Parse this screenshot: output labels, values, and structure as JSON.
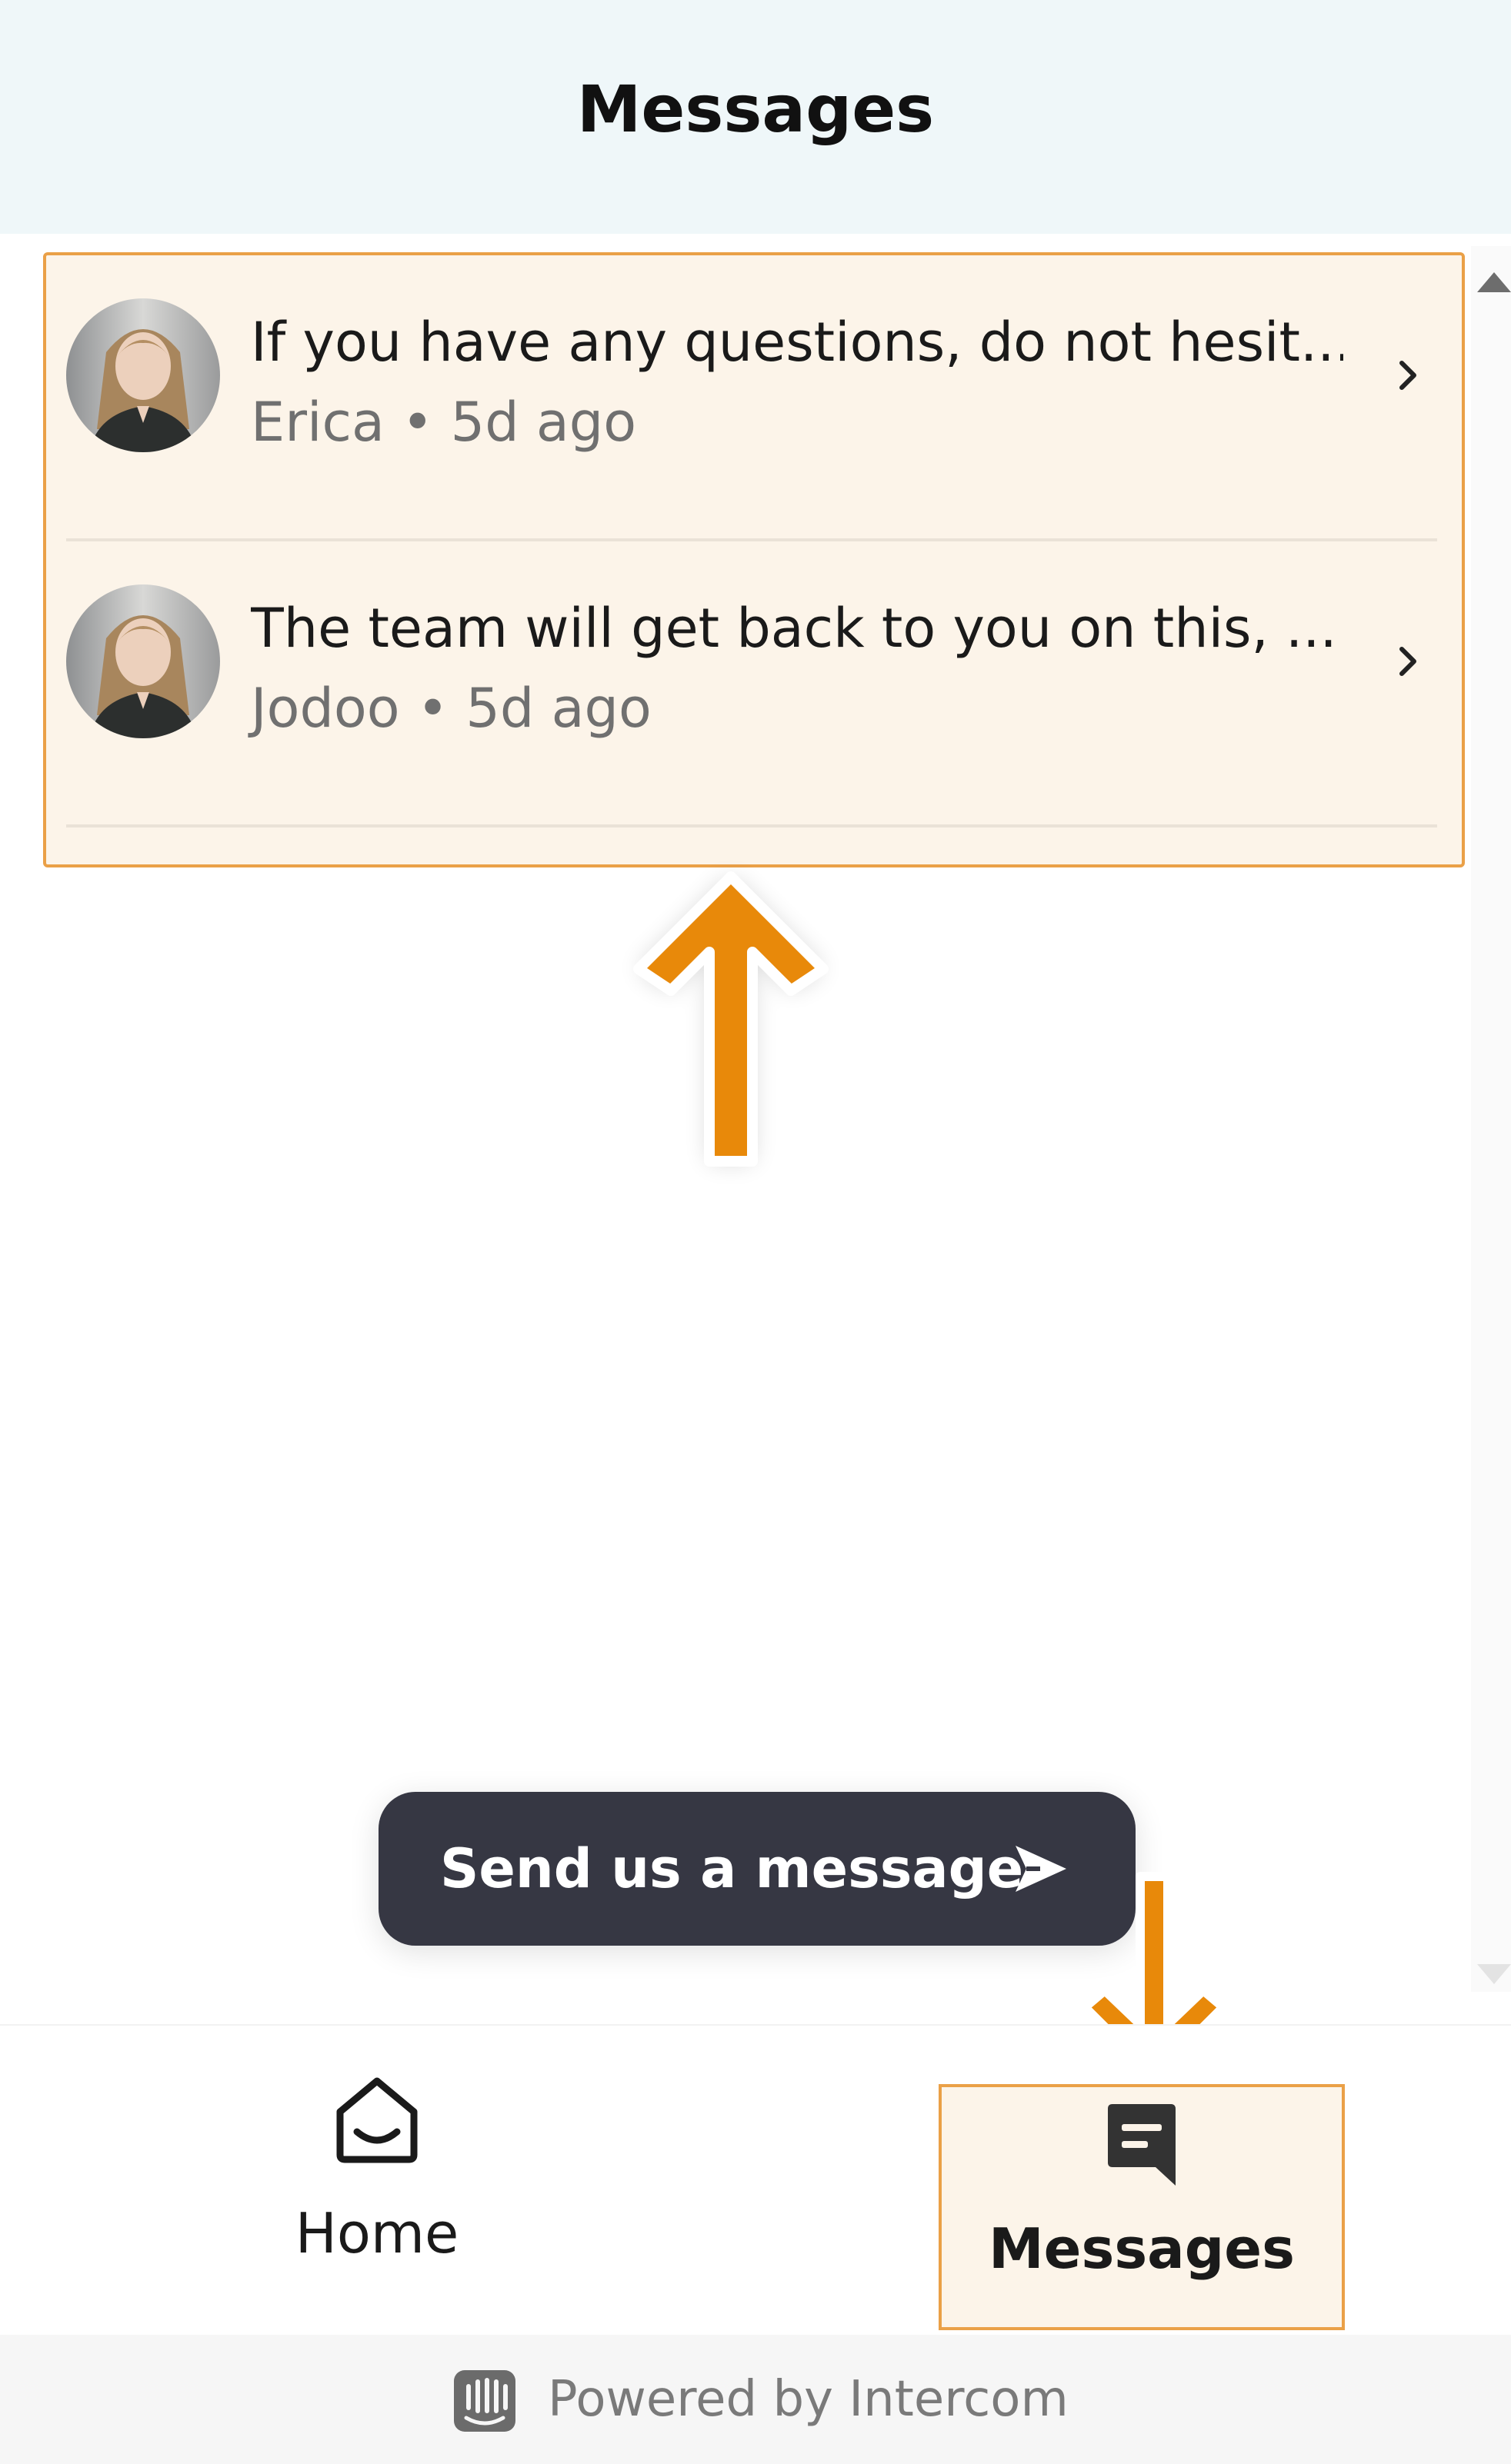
{
  "header": {
    "title": "Messages"
  },
  "conversations": [
    {
      "preview": "If you have any questions, do not hesit...",
      "sender": "Erica",
      "separator": "•",
      "time": "5d ago",
      "avatar_icon": "person-avatar"
    },
    {
      "preview": "The team will get back to you on this, ...",
      "sender": "Jodoo",
      "separator": "•",
      "time": "5d ago",
      "avatar_icon": "person-avatar"
    }
  ],
  "send_button": {
    "label": "Send us a message",
    "icon": "send-arrow-icon"
  },
  "nav": {
    "home_label": "Home",
    "home_icon": "home-icon",
    "messages_label": "Messages",
    "messages_icon": "chat-bubble-icon",
    "active": "messages"
  },
  "footer": {
    "powered_label": "Powered by Intercom",
    "icon": "intercom-logo-icon"
  },
  "colors": {
    "header_bg": "#eff7f9",
    "highlight_bg": "#fcf4e9",
    "highlight_border": "#eaa047",
    "annotation_arrow": "#e8890a",
    "button_bg": "#363743",
    "footer_bg": "#f6f6f6"
  },
  "annotations": [
    "arrow-up-to-conversation-list",
    "arrow-down-to-messages-tab"
  ]
}
